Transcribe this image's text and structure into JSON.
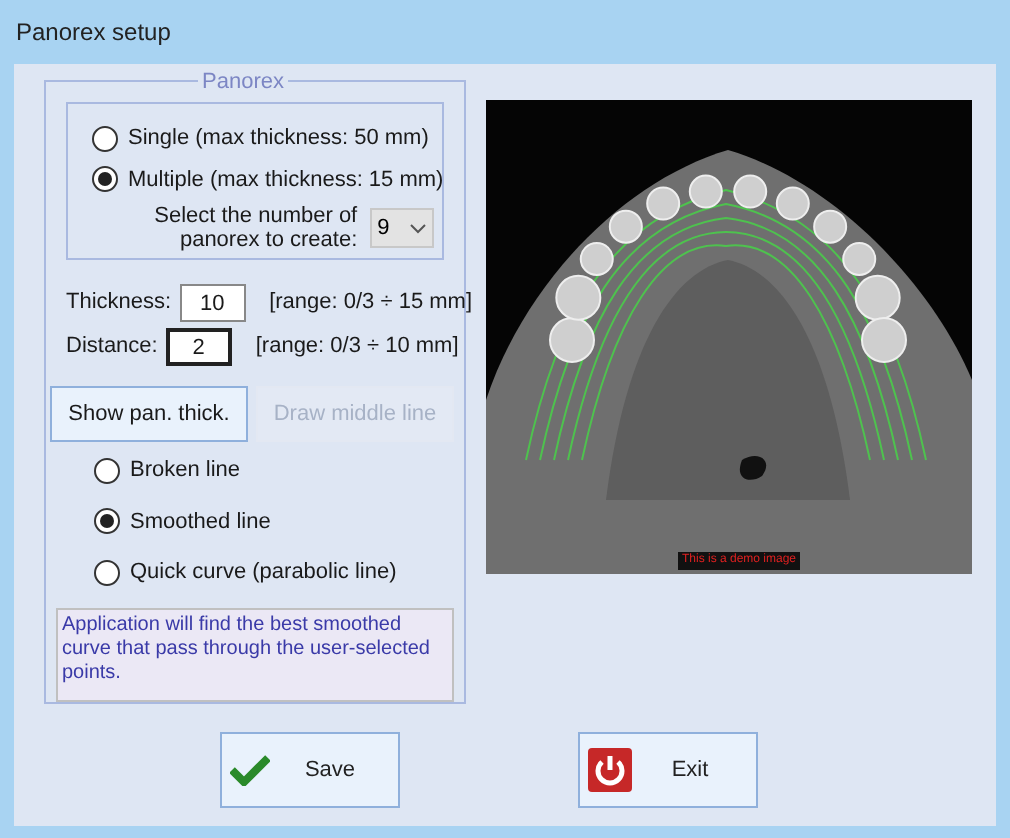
{
  "window": {
    "title": "Panorex setup"
  },
  "panorex_group": {
    "title": "Panorex",
    "modes": [
      {
        "label": "Single (max thickness: 50 mm)",
        "selected": false
      },
      {
        "label": "Multiple (max thickness: 15 mm)",
        "selected": true
      }
    ],
    "count_label": "Select the number of panorex to create:",
    "count_value": "9"
  },
  "thickness": {
    "label": "Thickness:",
    "value": "10",
    "range": "[range: 0/3 ÷ 15 mm]"
  },
  "distance": {
    "label": "Distance:",
    "value": "2",
    "range": "[range: 0/3 ÷ 10 mm]"
  },
  "action_buttons": [
    {
      "label": "Show pan. thick.",
      "disabled": false
    },
    {
      "label": "Draw middle line",
      "disabled": true
    }
  ],
  "line_types": [
    {
      "label": "Broken line",
      "selected": false
    },
    {
      "label": "Smoothed line",
      "selected": true
    },
    {
      "label": "Quick curve (parabolic line)",
      "selected": false
    }
  ],
  "description": "Application will find the best smoothed curve that pass through the user-selected points.",
  "image_caption": "This is a demo image",
  "buttons": [
    {
      "kind": "save",
      "label": "Save"
    },
    {
      "kind": "exit",
      "label": "Exit"
    }
  ]
}
